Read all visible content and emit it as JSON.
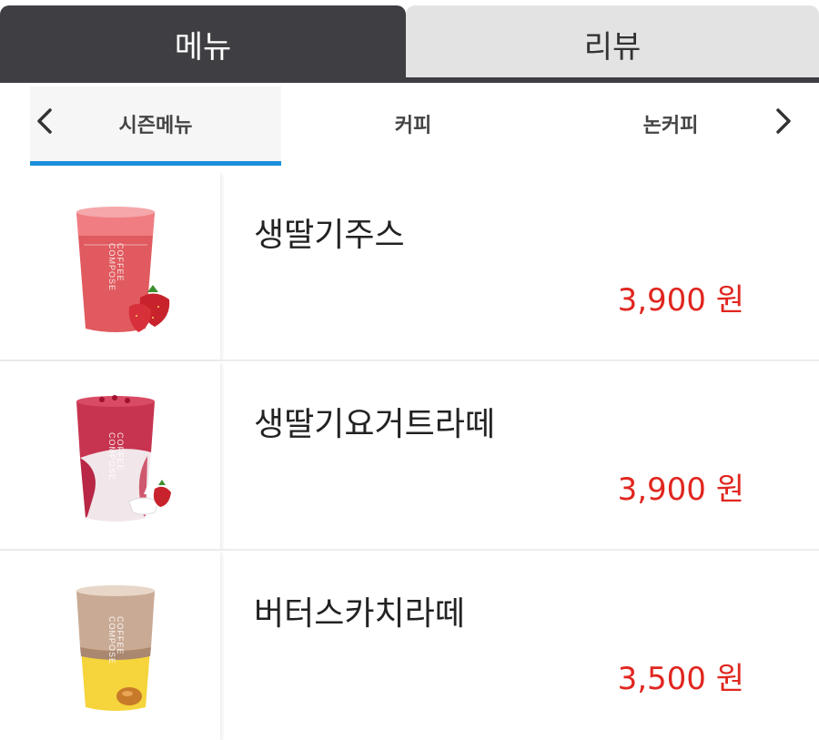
{
  "tabs": {
    "menu_label": "메뉴",
    "review_label": "리뷰"
  },
  "categories": {
    "items": [
      {
        "label": "시즌메뉴"
      },
      {
        "label": "커피"
      },
      {
        "label": "논커피"
      }
    ],
    "prev_icon": "chevron-left-icon",
    "next_icon": "chevron-right-icon"
  },
  "menu": {
    "items": [
      {
        "name": "생딸기주스",
        "price": "3,900 원",
        "image": "strawberry-juice-icon",
        "cup_brand": "COMPOSE COFFEE"
      },
      {
        "name": "생딸기요거트라떼",
        "price": "3,900 원",
        "image": "strawberry-yogurt-latte-icon",
        "cup_brand": "COMPOSE COFFEE"
      },
      {
        "name": "버터스카치라떼",
        "price": "3,500 원",
        "image": "butterscotch-latte-icon",
        "cup_brand": "COMPOSE COFFEE"
      }
    ]
  },
  "colors": {
    "active_tab": "#3f3f43",
    "inactive_tab": "#e3e3e3",
    "category_underline": "#1a8fdb",
    "price": "#e0261f"
  }
}
